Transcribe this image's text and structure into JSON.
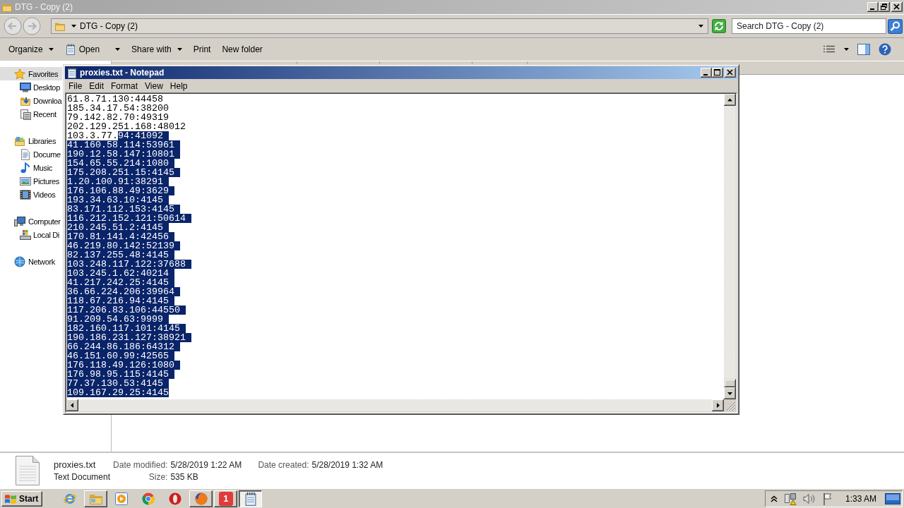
{
  "explorer": {
    "title": "DTG - Copy (2)",
    "address": "DTG - Copy (2)",
    "search": {
      "placeholder": "Search DTG - Copy (2)"
    },
    "toolbar": [
      {
        "label": "Organize",
        "kind": "menu"
      },
      {
        "label": "Open",
        "kind": "split"
      },
      {
        "label": "Share with",
        "kind": "menu"
      },
      {
        "label": "Print",
        "kind": "plain"
      },
      {
        "label": "New folder",
        "kind": "plain"
      }
    ],
    "nav": [
      {
        "label": "Favorites",
        "selected": true,
        "children": [
          {
            "label": "Desktop",
            "selected": false
          },
          {
            "label": "Downloa",
            "selected": false
          },
          {
            "label": "Recent",
            "selected": false
          }
        ]
      },
      {
        "label": "Libraries",
        "selected": false,
        "children": [
          {
            "label": "Docume",
            "selected": false
          },
          {
            "label": "Music",
            "selected": false
          },
          {
            "label": "Pictures",
            "selected": false
          },
          {
            "label": "Videos",
            "selected": false
          }
        ]
      },
      {
        "label": "Computer",
        "selected": false,
        "children": [
          {
            "label": "Local Di",
            "selected": false
          }
        ]
      },
      {
        "label": "Network",
        "selected": false
      }
    ],
    "details": {
      "name": "proxies.txt",
      "type": "Text Document",
      "fields": [
        {
          "label": "Date modified:",
          "value": "5/28/2019 1:22 AM"
        },
        {
          "label": "Date created:",
          "value": "5/28/2019 1:32 AM"
        },
        {
          "label": "Size:",
          "value": "535 KB"
        }
      ]
    }
  },
  "notepad": {
    "title": "proxies.txt - Notepad",
    "menu": [
      "File",
      "Edit",
      "Format",
      "View",
      "Help"
    ],
    "lines": [
      [
        {
          "text": "61.8.71.130:44458",
          "selected": false
        }
      ],
      [
        {
          "text": "185.34.17.54:38200",
          "selected": false
        }
      ],
      [
        {
          "text": "79.142.82.70:49319",
          "selected": false
        }
      ],
      [
        {
          "text": "202.129.251.168:48012",
          "selected": false
        }
      ],
      [
        {
          "text": "103.3.77.",
          "selected": false
        },
        {
          "text": "94:41092",
          "selected": true
        }
      ],
      [
        {
          "text": "41.160.58.114:53961",
          "selected": true
        }
      ],
      [
        {
          "text": "190.12.58.147:10801",
          "selected": true
        }
      ],
      [
        {
          "text": "154.65.55.214:1080",
          "selected": true
        }
      ],
      [
        {
          "text": "175.208.251.15:4145",
          "selected": true
        }
      ],
      [
        {
          "text": "1.20.100.91:38291",
          "selected": true
        }
      ],
      [
        {
          "text": "176.106.88.49:3629",
          "selected": true
        }
      ],
      [
        {
          "text": "193.34.63.10:4145",
          "selected": true
        }
      ],
      [
        {
          "text": "83.171.112.153:4145",
          "selected": true
        }
      ],
      [
        {
          "text": "116.212.152.121:50614",
          "selected": true
        }
      ],
      [
        {
          "text": "210.245.51.2:4145",
          "selected": true
        }
      ],
      [
        {
          "text": "170.81.141.4:42456",
          "selected": true
        }
      ],
      [
        {
          "text": "46.219.80.142:52139",
          "selected": true
        }
      ],
      [
        {
          "text": "82.137.255.48:4145",
          "selected": true
        }
      ],
      [
        {
          "text": "103.248.117.122:37688",
          "selected": true
        }
      ],
      [
        {
          "text": "103.245.1.62:40214",
          "selected": true
        }
      ],
      [
        {
          "text": "41.217.242.25:4145",
          "selected": true
        }
      ],
      [
        {
          "text": "36.66.224.206:39964",
          "selected": true
        }
      ],
      [
        {
          "text": "118.67.216.94:4145",
          "selected": true
        }
      ],
      [
        {
          "text": "117.206.83.106:44550",
          "selected": true
        }
      ],
      [
        {
          "text": "91.209.54.63:9999",
          "selected": true
        }
      ],
      [
        {
          "text": "182.160.117.101:4145",
          "selected": true
        }
      ],
      [
        {
          "text": "190.186.231.127:38921",
          "selected": true
        }
      ],
      [
        {
          "text": "66.244.86.186:64312",
          "selected": true
        }
      ],
      [
        {
          "text": "46.151.60.99:42565",
          "selected": true
        }
      ],
      [
        {
          "text": "176.118.49.126:1080",
          "selected": true
        }
      ],
      [
        {
          "text": "176.98.95.115:4145",
          "selected": true
        }
      ],
      [
        {
          "text": "77.37.130.53:4145",
          "selected": true
        }
      ],
      [
        {
          "text": "109.167.29.25:4145",
          "selected": true
        }
      ]
    ]
  },
  "taskbar": {
    "start": "Start",
    "items": [
      {
        "kind": "pinned",
        "selected": false
      },
      {
        "kind": "window",
        "selected": false
      },
      {
        "kind": "pinned",
        "selected": false
      },
      {
        "kind": "pinned",
        "selected": false
      },
      {
        "kind": "pinned",
        "selected": false
      },
      {
        "kind": "window",
        "selected": false
      },
      {
        "kind": "window",
        "selected": false,
        "glyph": "1"
      },
      {
        "kind": "window",
        "selected": true
      }
    ],
    "clock": "1:33 AM"
  }
}
